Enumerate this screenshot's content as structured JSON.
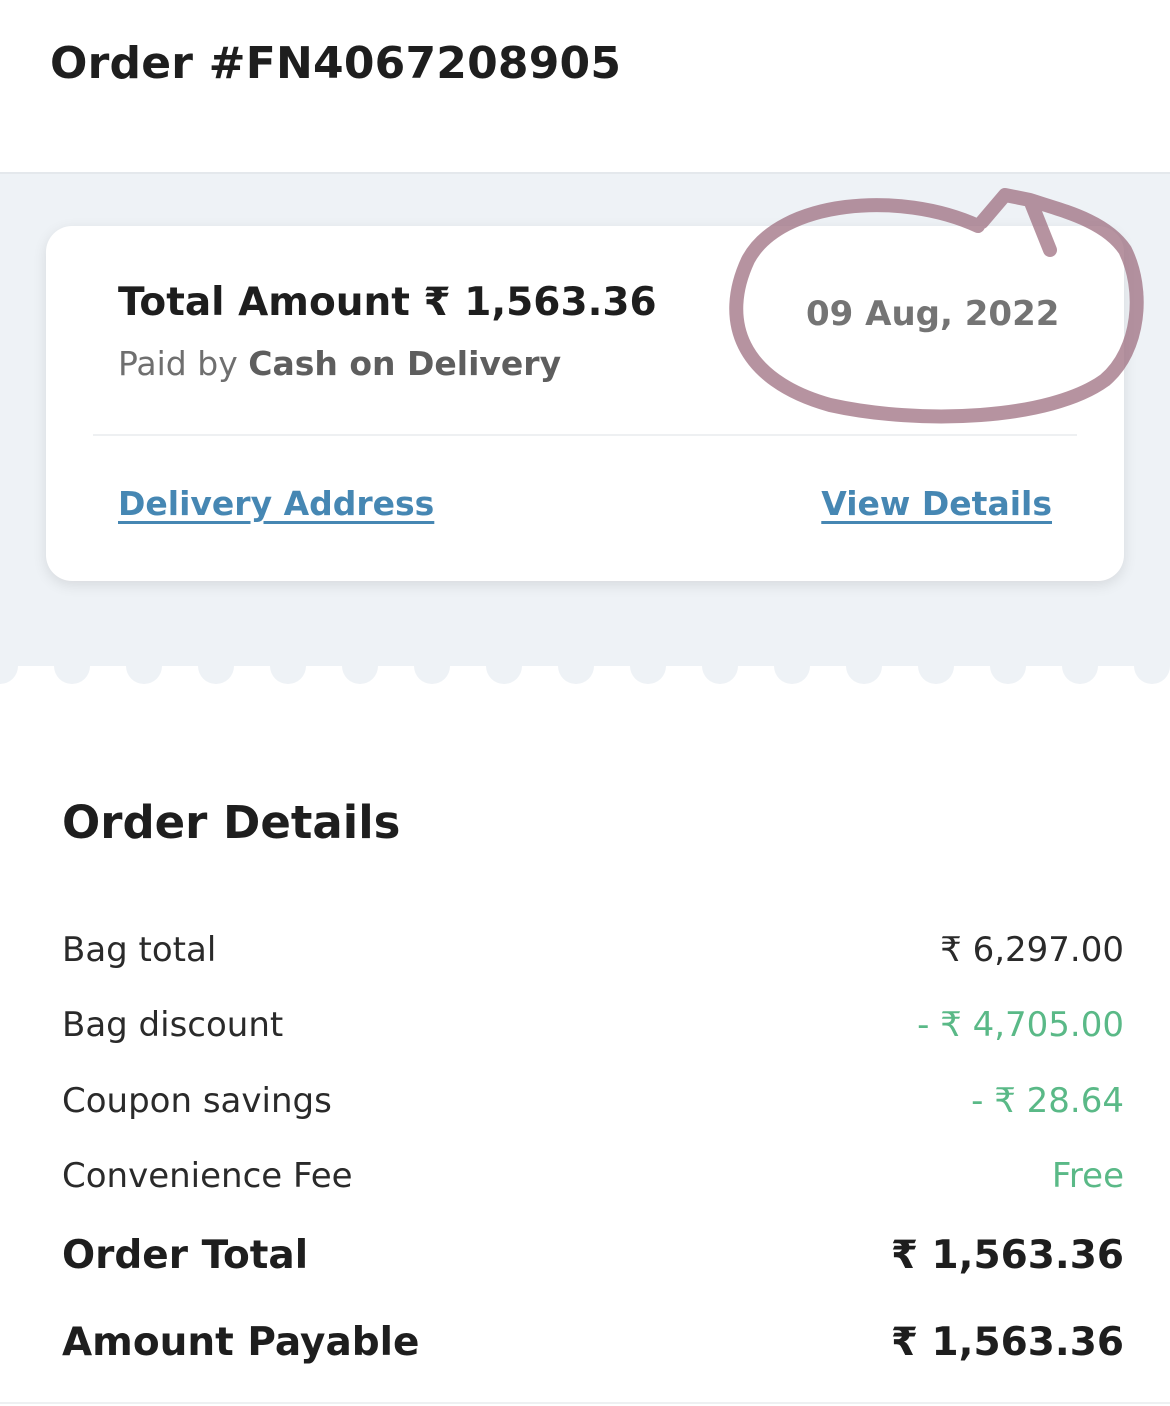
{
  "header": {
    "order_title": "Order #FN4067208905"
  },
  "summary_card": {
    "total_label": "Total Amount",
    "total_amount": "₹ 1,563.36",
    "paid_by_prefix": "Paid by",
    "payment_method": "Cash on Delivery",
    "order_date": "09 Aug, 2022",
    "delivery_address_link": "Delivery Address",
    "view_details_link": "View Details"
  },
  "order_details": {
    "title": "Order Details",
    "rows": [
      {
        "label": "Bag total",
        "value": "₹ 6,297.00"
      },
      {
        "label": "Bag discount",
        "value": "- ₹ 4,705.00"
      },
      {
        "label": "Coupon savings",
        "value": "- ₹ 28.64"
      },
      {
        "label": "Convenience Fee",
        "value": "Free"
      }
    ],
    "order_total_label": "Order Total",
    "order_total_value": "₹ 1,563.36",
    "amount_payable_label": "Amount Payable",
    "amount_payable_value": "₹ 1,563.36"
  },
  "colors": {
    "accent_link": "#4687b3",
    "savings_green": "#5ab987",
    "annotation_stroke": "#9e6f80",
    "band_bg": "#eef2f6"
  }
}
